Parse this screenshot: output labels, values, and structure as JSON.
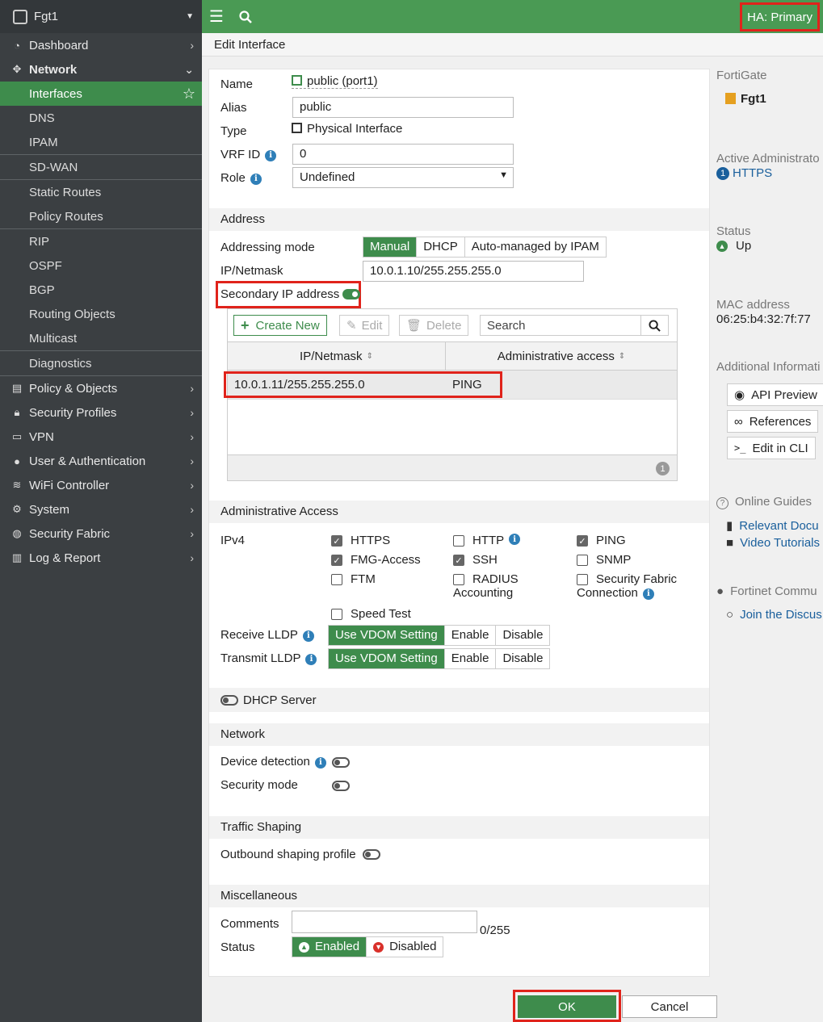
{
  "sidebar": {
    "device": "Fgt1",
    "items": [
      {
        "label": "Dashboard",
        "icon": "dashboard-icon"
      },
      {
        "label": "Network",
        "icon": "network-icon"
      },
      {
        "label": "Policy & Objects",
        "icon": "policy-icon"
      },
      {
        "label": "Security Profiles",
        "icon": "lock-icon"
      },
      {
        "label": "VPN",
        "icon": "laptop-icon"
      },
      {
        "label": "User & Authentication",
        "icon": "user-icon"
      },
      {
        "label": "WiFi Controller",
        "icon": "wifi-icon"
      },
      {
        "label": "System",
        "icon": "gear-icon"
      },
      {
        "label": "Security Fabric",
        "icon": "fabric-icon"
      },
      {
        "label": "Log & Report",
        "icon": "chart-icon"
      }
    ],
    "network_sub": [
      "Interfaces",
      "DNS",
      "IPAM",
      "SD-WAN",
      "Static Routes",
      "Policy Routes",
      "RIP",
      "OSPF",
      "BGP",
      "Routing Objects",
      "Multicast",
      "Diagnostics"
    ]
  },
  "topbar": {
    "ha_label": "HA:",
    "ha_value": "Primary"
  },
  "page_title": "Edit Interface",
  "form": {
    "name_label": "Name",
    "name_value": "public (port1)",
    "alias_label": "Alias",
    "alias_value": "public",
    "type_label": "Type",
    "type_value": "Physical Interface",
    "vrf_label": "VRF ID",
    "vrf_value": "0",
    "role_label": "Role",
    "role_value": "Undefined",
    "address_section": "Address",
    "addressing_mode_label": "Addressing mode",
    "addressing_modes": [
      "Manual",
      "DHCP",
      "Auto-managed by IPAM"
    ],
    "ipnetmask_label": "IP/Netmask",
    "ipnetmask_value": "10.0.1.10/255.255.255.0",
    "secondary_label": "Secondary IP address",
    "table": {
      "create_new": "Create New",
      "edit": "Edit",
      "delete": "Delete",
      "search_placeholder": "Search",
      "columns": [
        "IP/Netmask",
        "Administrative access"
      ],
      "rows": [
        {
          "ip": "10.0.1.11/255.255.255.0",
          "access": "PING"
        }
      ],
      "count": "1"
    },
    "admin_section": "Administrative Access",
    "ipv4_label": "IPv4",
    "checkboxes": [
      {
        "label": "HTTPS",
        "checked": true
      },
      {
        "label": "HTTP",
        "checked": false
      },
      {
        "label": "PING",
        "checked": true
      },
      {
        "label": "FMG-Access",
        "checked": true
      },
      {
        "label": "SSH",
        "checked": true
      },
      {
        "label": "SNMP",
        "checked": false
      },
      {
        "label": "FTM",
        "checked": false
      },
      {
        "label": "RADIUS",
        "label2": "Accounting",
        "checked": false
      },
      {
        "label": "Security Fabric",
        "label2": "Connection",
        "checked": false
      },
      {
        "label": "Speed Test",
        "checked": false
      }
    ],
    "receive_lldp_label": "Receive LLDP",
    "transmit_lldp_label": "Transmit LLDP",
    "lldp_options": [
      "Use VDOM Setting",
      "Enable",
      "Disable"
    ],
    "dhcp_server_label": "DHCP Server",
    "network_section": "Network",
    "device_detection_label": "Device detection",
    "security_mode_label": "Security mode",
    "traffic_section": "Traffic Shaping",
    "outbound_label": "Outbound shaping profile",
    "misc_section": "Miscellaneous",
    "comments_label": "Comments",
    "comments_count": "0/255",
    "status_label": "Status",
    "status_enabled": "Enabled",
    "status_disabled": "Disabled"
  },
  "right_panel": {
    "fortigate_h": "FortiGate",
    "fortigate_v": "Fgt1",
    "admins_h": "Active Administrato",
    "admins_count": "1",
    "admins_v": "HTTPS",
    "status_h": "Status",
    "status_v": "Up",
    "mac_h": "MAC address",
    "mac_v": "06:25:b4:32:7f:77",
    "addinfo_h": "Additional Informati",
    "api_preview": "API Preview",
    "references": "References",
    "edit_cli": "Edit in CLI",
    "guides_h": "Online Guides",
    "relevant_docs": "Relevant Docu",
    "video_tutorials": "Video Tutorials",
    "community_h": "Fortinet Commu",
    "join": "Join the Discus"
  },
  "buttons": {
    "ok": "OK",
    "cancel": "Cancel"
  },
  "colors": {
    "accent": "#3e8c4c",
    "sidebar": "#3b3f42",
    "highlight": "#e0231b"
  }
}
